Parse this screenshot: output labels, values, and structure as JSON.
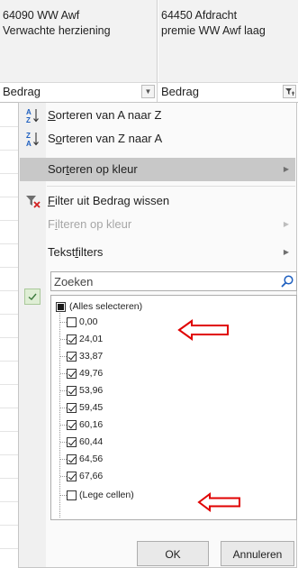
{
  "columns": [
    {
      "header_line1": "64090 WW Awf",
      "header_line2": "Verwachte herziening",
      "filter_label": "Bedrag"
    },
    {
      "header_line1": "64450 Afdracht",
      "header_line2": "premie WW Awf laag",
      "filter_label": "Bedrag"
    }
  ],
  "menu": {
    "sort_asc": {
      "pre": "",
      "u": "S",
      "post": "orteren van A naar Z"
    },
    "sort_desc": {
      "pre": "S",
      "u": "o",
      "post": "rteren van Z naar A"
    },
    "sort_color": {
      "pre": "Sor",
      "u": "t",
      "post": "eren op kleur"
    },
    "clear_filter": {
      "pre": "",
      "u": "F",
      "post": "ilter uit Bedrag wissen"
    },
    "filter_color": {
      "pre": "F",
      "u": "i",
      "post": "lteren op kleur"
    },
    "text_filters": {
      "pre": "Tekst",
      "u": "f",
      "post": "ilters"
    }
  },
  "search": {
    "placeholder": "Zoeken"
  },
  "list": {
    "select_all": "(Alles selecteren)",
    "items": [
      {
        "label": "0,00",
        "checked": false
      },
      {
        "label": "24,01",
        "checked": true
      },
      {
        "label": "33,87",
        "checked": true
      },
      {
        "label": "49,76",
        "checked": true
      },
      {
        "label": "53,96",
        "checked": true
      },
      {
        "label": "59,45",
        "checked": true
      },
      {
        "label": "60,16",
        "checked": true
      },
      {
        "label": "60,44",
        "checked": true
      },
      {
        "label": "64,56",
        "checked": true
      },
      {
        "label": "67,66",
        "checked": true
      },
      {
        "label": "(Lege cellen)",
        "checked": false
      }
    ]
  },
  "buttons": {
    "ok": "OK",
    "cancel": "Annuleren"
  },
  "colors": {
    "annotation_arrow": "#e00000",
    "hover_row": "#c8c8c8",
    "sort_icon_blue": "#1e5fbf"
  }
}
